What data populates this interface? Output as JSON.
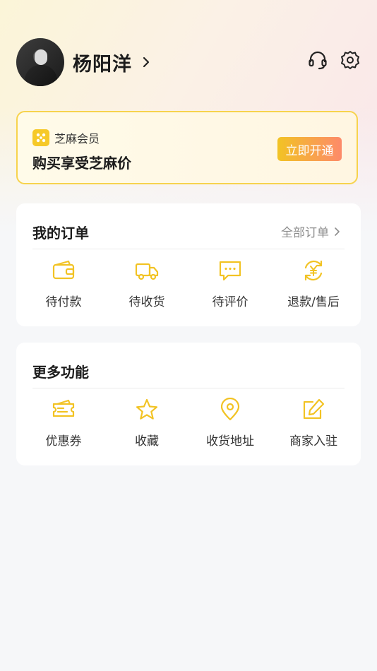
{
  "profile": {
    "name": "杨阳洋"
  },
  "header_icons": [
    "headset-icon",
    "settings-gear-icon"
  ],
  "zhima": {
    "label": "芝麻会员",
    "title": "购买享受芝麻价",
    "button": "立即开通",
    "colors": {
      "border": "#f7d34d",
      "btn_start": "#f2c324",
      "btn_end": "#fd8a6a"
    }
  },
  "orders": {
    "title": "我的订单",
    "all_link": "全部订单",
    "items": [
      {
        "label": "待付款",
        "icon": "wallet-icon"
      },
      {
        "label": "待收货",
        "icon": "truck-icon"
      },
      {
        "label": "待评价",
        "icon": "comment-icon"
      },
      {
        "label": "退款/售后",
        "icon": "refund-yen-icon"
      }
    ]
  },
  "more": {
    "title": "更多功能",
    "items": [
      {
        "label": "优惠券",
        "icon": "coupon-icon"
      },
      {
        "label": "收藏",
        "icon": "star-icon"
      },
      {
        "label": "收货地址",
        "icon": "location-pin-icon"
      },
      {
        "label": "商家入驻",
        "icon": "edit-icon"
      }
    ]
  },
  "accent_color": "#f6c928"
}
